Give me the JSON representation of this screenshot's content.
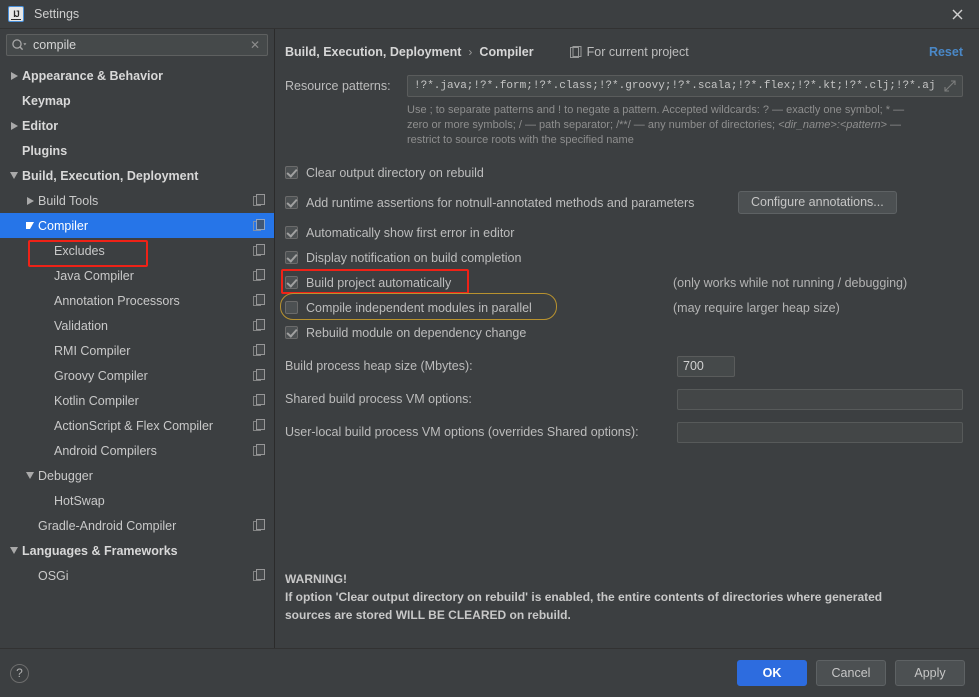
{
  "window": {
    "title": "Settings",
    "app_icon": "intellij-idea-icon",
    "close_icon": "close-icon"
  },
  "search": {
    "value": "compile",
    "placeholder": "",
    "icon": "search-icon",
    "clear_icon": "clear-icon"
  },
  "sidebar": {
    "items": [
      {
        "label": "Appearance & Behavior",
        "indent": 0,
        "arrow": "collapsed",
        "bold": true,
        "copy": false,
        "selected": false
      },
      {
        "label": "Keymap",
        "indent": 0,
        "arrow": "none",
        "bold": true,
        "copy": false,
        "selected": false
      },
      {
        "label": "Editor",
        "indent": 0,
        "arrow": "collapsed",
        "bold": true,
        "copy": false,
        "selected": false
      },
      {
        "label": "Plugins",
        "indent": 0,
        "arrow": "none",
        "bold": true,
        "copy": false,
        "selected": false
      },
      {
        "label": "Build, Execution, Deployment",
        "indent": 0,
        "arrow": "expanded",
        "bold": true,
        "copy": false,
        "selected": false
      },
      {
        "label": "Build Tools",
        "indent": 1,
        "arrow": "collapsed",
        "bold": false,
        "copy": true,
        "selected": false
      },
      {
        "label": "Compiler",
        "indent": 1,
        "arrow": "expanded",
        "bold": false,
        "copy": true,
        "selected": true
      },
      {
        "label": "Excludes",
        "indent": 2,
        "arrow": "none",
        "bold": false,
        "copy": true,
        "selected": false
      },
      {
        "label": "Java Compiler",
        "indent": 2,
        "arrow": "none",
        "bold": false,
        "copy": true,
        "selected": false
      },
      {
        "label": "Annotation Processors",
        "indent": 2,
        "arrow": "none",
        "bold": false,
        "copy": true,
        "selected": false
      },
      {
        "label": "Validation",
        "indent": 2,
        "arrow": "none",
        "bold": false,
        "copy": true,
        "selected": false
      },
      {
        "label": "RMI Compiler",
        "indent": 2,
        "arrow": "none",
        "bold": false,
        "copy": true,
        "selected": false
      },
      {
        "label": "Groovy Compiler",
        "indent": 2,
        "arrow": "none",
        "bold": false,
        "copy": true,
        "selected": false
      },
      {
        "label": "Kotlin Compiler",
        "indent": 2,
        "arrow": "none",
        "bold": false,
        "copy": true,
        "selected": false
      },
      {
        "label": "ActionScript & Flex Compiler",
        "indent": 2,
        "arrow": "none",
        "bold": false,
        "copy": true,
        "selected": false
      },
      {
        "label": "Android Compilers",
        "indent": 2,
        "arrow": "none",
        "bold": false,
        "copy": true,
        "selected": false
      },
      {
        "label": "Debugger",
        "indent": 1,
        "arrow": "expanded",
        "bold": false,
        "copy": false,
        "selected": false
      },
      {
        "label": "HotSwap",
        "indent": 2,
        "arrow": "none",
        "bold": false,
        "copy": false,
        "selected": false
      },
      {
        "label": "Gradle-Android Compiler",
        "indent": 1,
        "arrow": "none",
        "bold": false,
        "copy": true,
        "selected": false
      },
      {
        "label": "Languages & Frameworks",
        "indent": 0,
        "arrow": "expanded",
        "bold": true,
        "copy": false,
        "selected": false
      },
      {
        "label": "OSGi",
        "indent": 1,
        "arrow": "none",
        "bold": false,
        "copy": true,
        "selected": false
      }
    ]
  },
  "header": {
    "breadcrumb_parent": "Build, Execution, Deployment",
    "breadcrumb_sep": "›",
    "breadcrumb_current": "Compiler",
    "scope_icon": "project-scope-icon",
    "scope_label": "For current project",
    "reset_label": "Reset"
  },
  "main": {
    "resource_patterns_label": "Resource patterns:",
    "resource_patterns_value": "!?*.java;!?*.form;!?*.class;!?*.groovy;!?*.scala;!?*.flex;!?*.kt;!?*.clj;!?*.aj",
    "expand_icon": "expand-field-icon",
    "hint_line1": "Use ; to separate patterns and ! to negate a pattern. Accepted wildcards: ? — exactly one symbol; * —",
    "hint_line2_a": "zero or more symbols; / — path separator; /**/ — any number of directories; ",
    "hint_line2_b": "<dir_name>:<pattern>",
    "hint_line2_c": " —",
    "hint_line3": "restrict to source roots with the specified name",
    "checkboxes": [
      {
        "label": "Clear output directory on rebuild",
        "checked": true
      },
      {
        "label": "Add runtime assertions for notnull-annotated methods and parameters",
        "checked": true
      },
      {
        "label": "Automatically show first error in editor",
        "checked": true
      },
      {
        "label": "Display notification on build completion",
        "checked": true
      },
      {
        "label": "Build project automatically",
        "checked": true
      },
      {
        "label": "Compile independent modules in parallel",
        "checked": false
      },
      {
        "label": "Rebuild module on dependency change",
        "checked": true
      }
    ],
    "configure_annotations_label": "Configure annotations...",
    "note_build_auto": "(only works while not running / debugging)",
    "note_parallel": "(may require larger heap size)",
    "heap_label": "Build process heap size (Mbytes):",
    "heap_value": "700",
    "shared_vm_label": "Shared build process VM options:",
    "shared_vm_value": "",
    "userlocal_vm_label": "User-local build process VM options (overrides Shared options):",
    "userlocal_vm_value": "",
    "warning_title": "WARNING!",
    "warning_line1": "If option 'Clear output directory on rebuild' is enabled, the entire contents of directories where generated",
    "warning_line2": "sources are stored WILL BE CLEARED on rebuild."
  },
  "footer": {
    "help_icon": "help-icon",
    "ok_label": "OK",
    "cancel_label": "Cancel",
    "apply_label": "Apply"
  },
  "annotations": {
    "red_color": "#ef2217",
    "gold_color": "#b8922f"
  },
  "colors": {
    "background": "#3c3f41",
    "selection": "#2675e8",
    "accent_link": "#4a88c7",
    "primary_button": "#2d6cdf"
  }
}
